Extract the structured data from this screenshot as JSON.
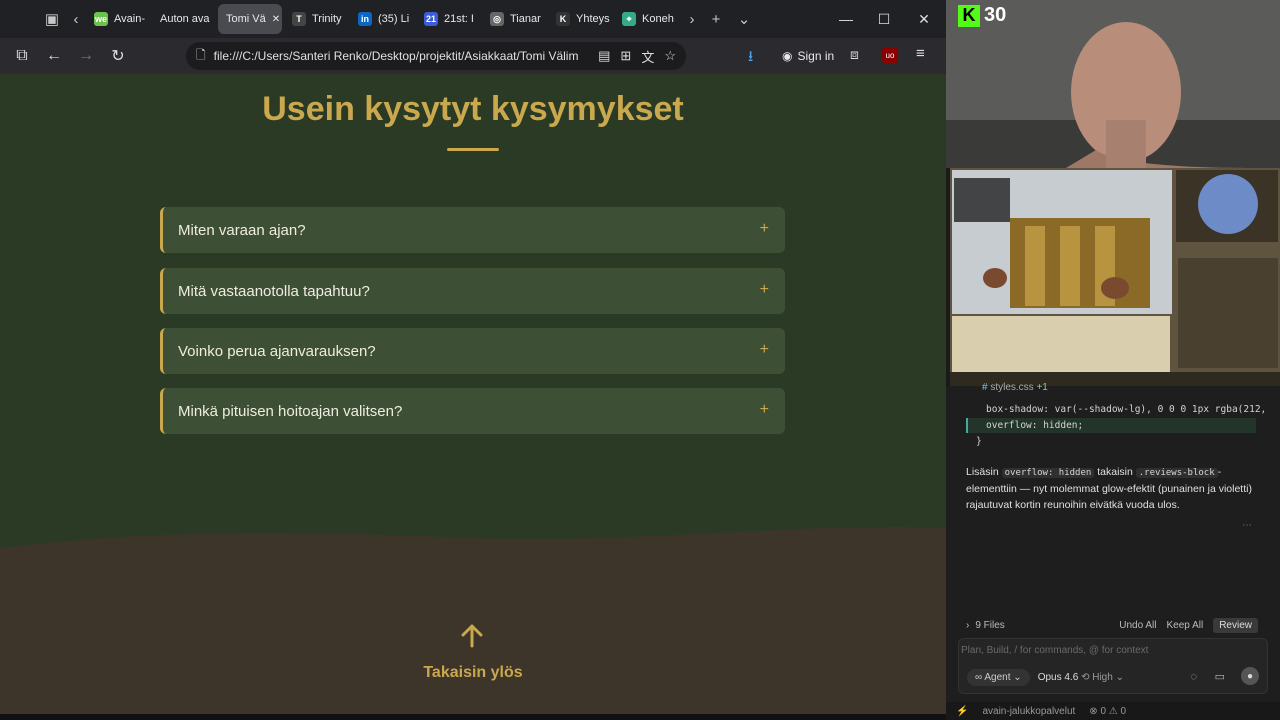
{
  "browser": {
    "tabs": [
      {
        "label": "Avain-",
        "icon": "we",
        "color": "#6cc24a"
      },
      {
        "label": "Auton ava",
        "icon": "",
        "color": ""
      },
      {
        "label": "Tomi Vä",
        "icon": "",
        "color": "",
        "active": true
      },
      {
        "label": "Trinity",
        "icon": "T",
        "color": "#444"
      },
      {
        "label": "(35) Li",
        "icon": "in",
        "color": "#0a66c2"
      },
      {
        "label": "21st: I",
        "icon": "21",
        "color": "#3b5bdb"
      },
      {
        "label": "Tianar",
        "icon": "◎",
        "color": "#666"
      },
      {
        "label": "Yhteys",
        "icon": "K",
        "color": "#333"
      },
      {
        "label": "Koneh",
        "icon": "⌖",
        "color": "#3a8"
      }
    ],
    "url": "file:///C:/Users/Santeri Renko/Desktop/projektit/Asiakkaat/Tomi Välim",
    "sign_in": "Sign in"
  },
  "faq": {
    "title": "Usein kysytyt kysymykset",
    "items": [
      {
        "question": "Miten varaan ajan?"
      },
      {
        "question": "Mitä vastaanotolla tapahtuu?"
      },
      {
        "question": "Voinko perua ajanvarauksen?"
      },
      {
        "question": "Minkä pituisen hoitoajan valitsen?"
      }
    ]
  },
  "footer": {
    "back_to_top": "Takaisin ylös"
  },
  "stream": {
    "kick_count": "30"
  },
  "editor": {
    "file": "styles.css",
    "file_delta": "+1",
    "code_lines": [
      "box-shadow: var(--shadow-lg), 0 0 0 1px rgba(212,",
      "overflow: hidden;",
      "}"
    ],
    "message_parts": {
      "a": "Lisäsin",
      "code1": "overflow: hidden",
      "b": "takaisin",
      "code2": ".reviews-block",
      "c": "-elementtiin — nyt molemmat glow-efektit (punainen ja violetti) rajautuvat kortin reunoihin eivätkä vuoda ulos."
    },
    "files_label": "9 Files",
    "undo_all": "Undo All",
    "keep_all": "Keep All",
    "review": "Review",
    "input_placeholder": "Plan, Build, / for commands, @ for context",
    "agent_label": "Agent",
    "model_label": "Opus 4.6",
    "effort_label": "High",
    "status_project": "avain-jalukkopalvelut",
    "status_counts": "⊗ 0 ⚠ 0"
  }
}
